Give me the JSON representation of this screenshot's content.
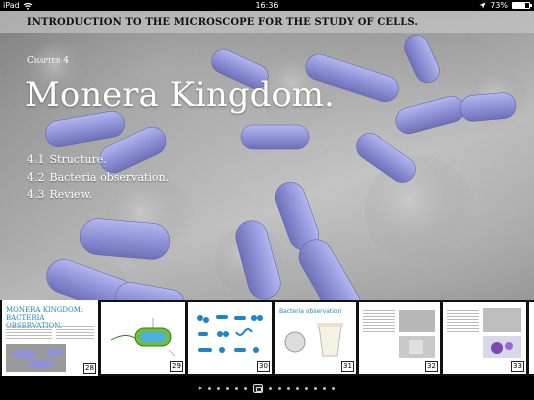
{
  "status_bar": {
    "device": "iPad",
    "time": "16:36",
    "battery": "73%",
    "battery_level": 0.73
  },
  "book": {
    "title": "INTRODUCTION TO THE MICROSCOPE FOR THE STUDY OF CELLS."
  },
  "chapter": {
    "label": "Chapter 4",
    "title": "Monera Kingdom.",
    "toc": [
      {
        "number": "4.1",
        "label": "Structure."
      },
      {
        "number": "4.2",
        "label": "Bacteria observation."
      },
      {
        "number": "4.3",
        "label": "Review."
      }
    ]
  },
  "thumbnails": [
    {
      "page": "28",
      "title": "MONERA KINGDOM: BACTERIA OBSERVATION."
    },
    {
      "page": "29"
    },
    {
      "page": "30"
    },
    {
      "page": "31",
      "title": "Bacteria observation"
    },
    {
      "page": "32"
    },
    {
      "page": "33"
    }
  ],
  "pager": {
    "dot_count": 14,
    "active_index": 5
  },
  "colors": {
    "bacteria": "#8f92d6",
    "accent": "#1a86c9"
  }
}
